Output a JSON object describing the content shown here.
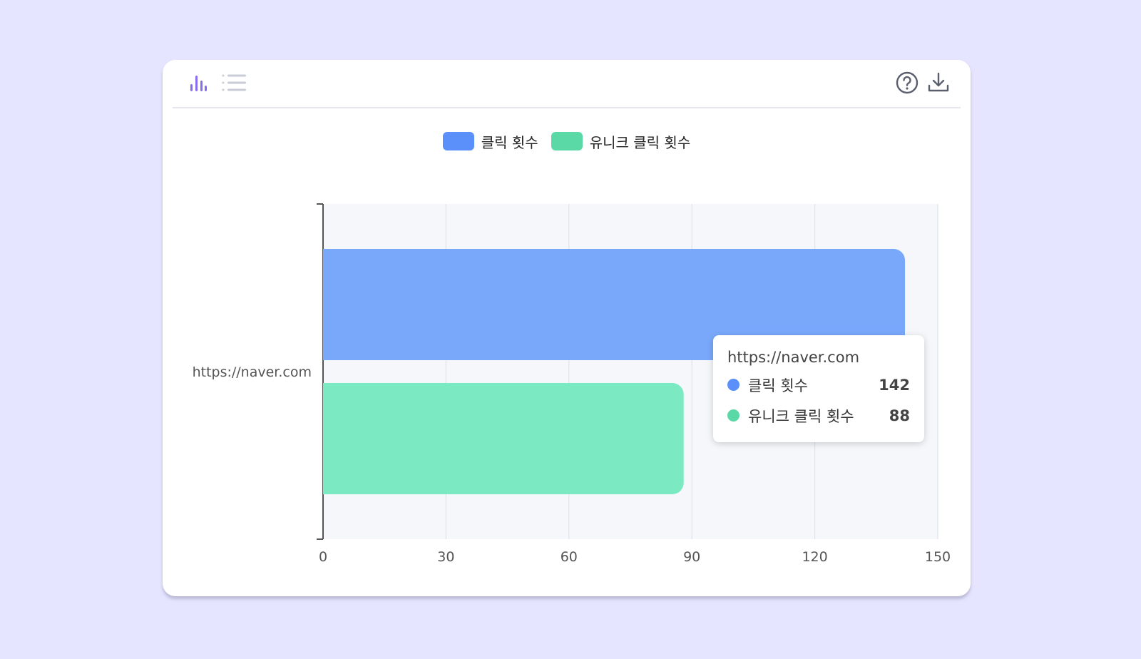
{
  "toolbar": {
    "icons": [
      "bar-chart-icon",
      "list-icon",
      "help-icon",
      "download-icon"
    ],
    "active_color": "#8b6cf0",
    "inactive_color": "#c9ccd6"
  },
  "chart_data": {
    "type": "bar",
    "orientation": "horizontal",
    "categories": [
      "https://naver.com"
    ],
    "series": [
      {
        "name": "클릭 횟수",
        "values": [
          142
        ],
        "color": "#79a8fb",
        "legend_color": "#5b8ff9"
      },
      {
        "name": "유니크 클릭 횟수",
        "values": [
          88
        ],
        "color": "#7beac2",
        "legend_color": "#5ad8a6"
      }
    ],
    "xlim": [
      0,
      150
    ],
    "xticks": [
      0,
      30,
      60,
      90,
      120,
      150
    ],
    "grid": true,
    "legend": "top-center"
  },
  "tooltip": {
    "title": "https://naver.com",
    "rows": [
      {
        "name": "클릭 횟수",
        "value": "142",
        "color": "#5b8ff9"
      },
      {
        "name": "유니크 클릭 횟수",
        "value": "88",
        "color": "#5ad8a6"
      }
    ]
  }
}
